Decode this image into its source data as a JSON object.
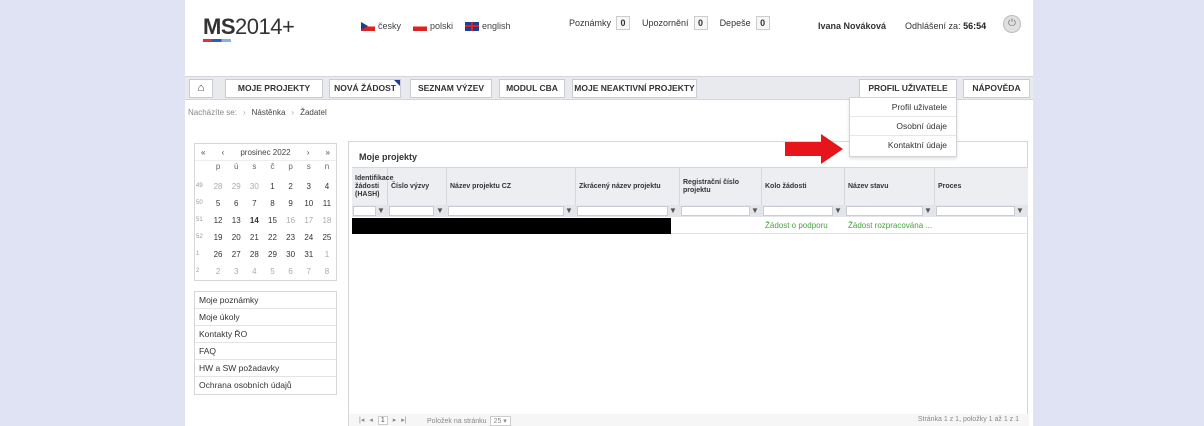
{
  "header": {
    "logo_text": "MS",
    "logo_num": "2014+",
    "languages": [
      {
        "label": "česky",
        "icon": "flag-cz"
      },
      {
        "label": "polski",
        "icon": "flag-pl"
      },
      {
        "label": "english",
        "icon": "flag-en"
      }
    ],
    "counters": [
      {
        "label": "Poznámky",
        "value": "0"
      },
      {
        "label": "Upozornění",
        "value": "0"
      },
      {
        "label": "Depeše",
        "value": "0"
      }
    ],
    "user_name": "Ivana Nováková",
    "logout_label": "Odhlášení za:",
    "logout_time": "56:54",
    "power_icon": "power-icon"
  },
  "nav": {
    "home_icon": "home-icon",
    "items": [
      "MOJE PROJEKTY",
      "NOVÁ ŽÁDOST",
      "SEZNAM VÝZEV",
      "MODUL CBA",
      "MOJE NEAKTIVNÍ PROJEKTY"
    ],
    "profile": "PROFIL UŽIVATELE",
    "help": "NÁPOVĚDA",
    "accent": "#1c3f94"
  },
  "profile_menu": [
    "Profil uživatele",
    "Osobní údaje",
    "Kontaktní údaje"
  ],
  "breadcrumb": {
    "label": "Nacházíte se:",
    "items": [
      "Nástěnka",
      "Žadatel"
    ]
  },
  "calendar": {
    "month": "prosinec 2022",
    "weekdays": [
      "p",
      "ú",
      "s",
      "č",
      "p",
      "s",
      "n"
    ],
    "weeks": [
      {
        "wk": "49",
        "days": [
          "28",
          "29",
          "30",
          "1",
          "2",
          "3",
          "4"
        ]
      },
      {
        "wk": "50",
        "days": [
          "5",
          "6",
          "7",
          "8",
          "9",
          "10",
          "11"
        ]
      },
      {
        "wk": "51",
        "days": [
          "12",
          "13",
          "14",
          "15",
          "16",
          "17",
          "18"
        ]
      },
      {
        "wk": "52",
        "days": [
          "19",
          "20",
          "21",
          "22",
          "23",
          "24",
          "25"
        ]
      },
      {
        "wk": "1",
        "days": [
          "26",
          "27",
          "28",
          "29",
          "30",
          "31",
          "1"
        ]
      },
      {
        "wk": "2",
        "days": [
          "2",
          "3",
          "4",
          "5",
          "6",
          "7",
          "8"
        ]
      }
    ]
  },
  "side_links": [
    "Moje poznámky",
    "Moje úkoly",
    "Kontakty ŘO",
    "FAQ",
    "HW a SW požadavky",
    "Ochrana osobních údajů"
  ],
  "panel": {
    "title": "Moje projekty",
    "columns": [
      "Identifikace žádosti (HASH)",
      "Číslo výzvy",
      "Název projektu CZ",
      "Zkrácený název projektu",
      "Registrační číslo projektu",
      "Kolo žádosti",
      "Název stavu",
      "Proces"
    ],
    "row": {
      "kolo": "Žádost o podporu",
      "stav": "Žádost rozpracována ..."
    },
    "pager": {
      "page": "1",
      "per_page_label": "Položek na stránku",
      "per_page": "25",
      "info": "Stránka 1 z 1, položky 1 až 1 z 1"
    }
  },
  "colors": {
    "green_text": "#47a23f",
    "highlight_arrow": "#e8141b"
  }
}
